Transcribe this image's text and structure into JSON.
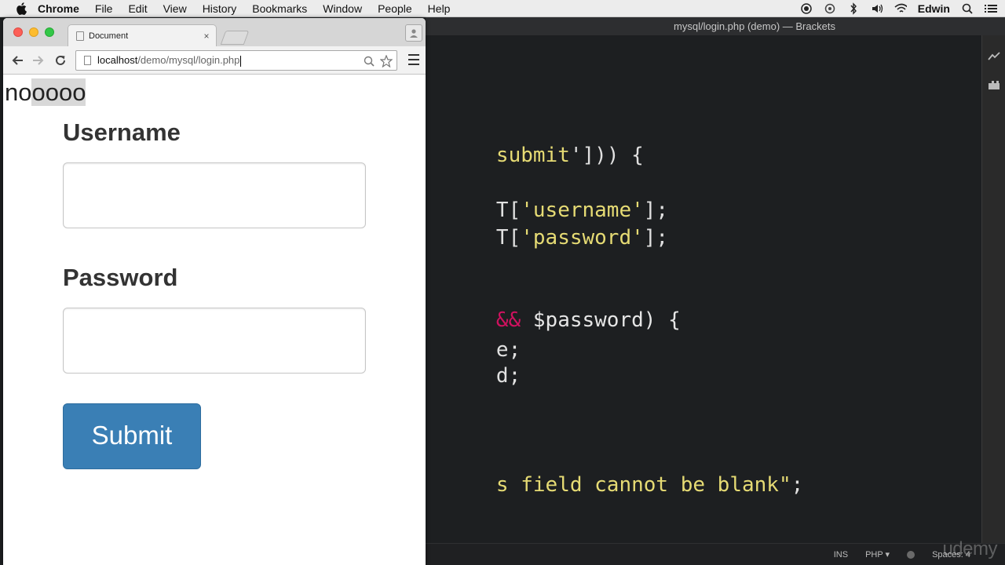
{
  "menubar": {
    "app_name": "Chrome",
    "items": [
      "File",
      "Edit",
      "View",
      "History",
      "Bookmarks",
      "Window",
      "People",
      "Help"
    ],
    "user": "Edwin"
  },
  "browser": {
    "tab_title": "Document",
    "tab_close": "×",
    "url_host": "localhost",
    "url_path": "/demo/mysql/login.php"
  },
  "page": {
    "debug_prefix": "no",
    "debug_selected": "oooo",
    "username_label": "Username",
    "password_label": "Password",
    "submit_label": "Submit"
  },
  "editor": {
    "title": "mysql/login.php (demo) — Brackets",
    "lines": [
      {
        "text_a": "submit'])) {"
      },
      {
        "prefix": "T[",
        "str": "'username'",
        "suffix": "];"
      },
      {
        "prefix": "T[",
        "str": "'password'",
        "suffix": "];"
      },
      {
        "op": "&&",
        "rest": " $password) {"
      },
      {
        "text_a": "e;"
      },
      {
        "text_a": "d;"
      },
      {
        "str": "s field cannot be blank\"",
        "suffix": ";"
      }
    ],
    "status": {
      "mode": "INS",
      "language": "PHP ▾",
      "spaces": "Spaces: 4"
    },
    "watermark": "udemy"
  },
  "colors": {
    "string": "#e6db74",
    "operator": "#d0115f",
    "submit_button": "#3a7fb5"
  }
}
